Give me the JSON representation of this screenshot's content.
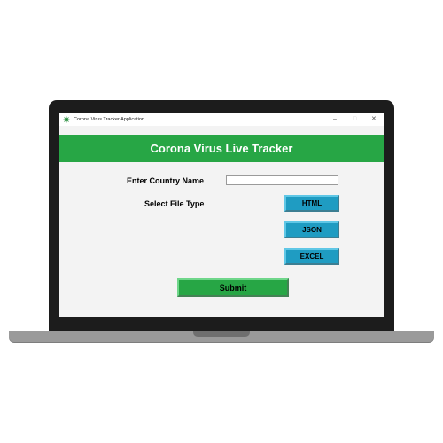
{
  "window": {
    "title": "Corona Virus Tracker Application",
    "controls": {
      "minimize": "–",
      "maximize": "□",
      "close": "✕"
    }
  },
  "header": {
    "title": "Corona Virus Live Tracker"
  },
  "form": {
    "country_label": "Enter Country Name",
    "country_value": "",
    "file_type_label": "Select File Type",
    "file_types": [
      "HTML",
      "JSON",
      "EXCEL"
    ],
    "submit_label": "Submit"
  },
  "colors": {
    "header_green": "#27a645",
    "button_blue": "#1f9cc2",
    "submit_green": "#27a645",
    "window_bg": "#f3f3f3"
  },
  "icons": {
    "app": "virus-icon"
  }
}
